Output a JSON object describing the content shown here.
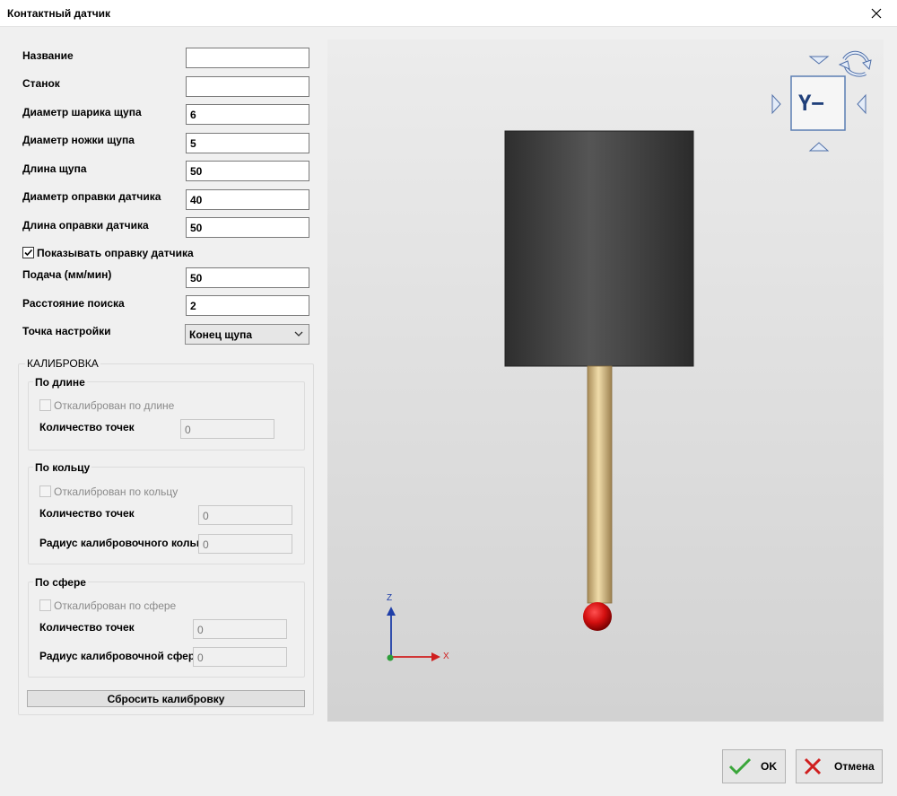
{
  "window": {
    "title": "Контактный датчик"
  },
  "form": {
    "name_label": "Название",
    "name_value": "",
    "machine_label": "Станок",
    "machine_value": "",
    "ball_diam_label": "Диаметр шарика щупа",
    "ball_diam_value": "6",
    "stem_diam_label": "Диаметр ножки щупа",
    "stem_diam_value": "5",
    "stylus_len_label": "Длина щупа",
    "stylus_len_value": "50",
    "holder_diam_label": "Диаметр оправки датчика",
    "holder_diam_value": "40",
    "holder_len_label": "Длина оправки датчика",
    "holder_len_value": "50",
    "show_holder_label": "Показывать оправку датчика",
    "show_holder_checked": true,
    "feed_label": "Подача (мм/мин)",
    "feed_value": "50",
    "search_dist_label": "Расстояние поиска",
    "search_dist_value": "2",
    "setpoint_label": "Точка настройки",
    "setpoint_value": "Конец щупа"
  },
  "calibration": {
    "title": "КАЛИБРОВКА",
    "by_length": {
      "title": "По длине",
      "checkbox_label": "Откалиброван по длине",
      "points_label": "Количество точек",
      "points_value": "0"
    },
    "by_ring": {
      "title": "По кольцу",
      "checkbox_label": "Откалиброван по кольцу",
      "points_label": "Количество точек",
      "points_value": "0",
      "radius_label": "Радиус калибровочного кольца",
      "radius_value": "0"
    },
    "by_sphere": {
      "title": "По сфере",
      "checkbox_label": "Откалиброван по сфере",
      "points_label": "Количество точек",
      "points_value": "0",
      "radius_label": "Радиус калибровочной сферы",
      "radius_value": "0"
    },
    "reset_label": "Сбросить калибровку"
  },
  "viewport": {
    "view_cube_label": "Y−",
    "axis_z": "Z",
    "axis_x": "X",
    "colors": {
      "holder": "#3c3c3c",
      "stem": "#d9bf8c",
      "ball": "#e01010",
      "axis_z": "#1f3fa8",
      "axis_x": "#d01f1f"
    }
  },
  "buttons": {
    "ok_label": "OK",
    "cancel_label": "Отмена"
  }
}
